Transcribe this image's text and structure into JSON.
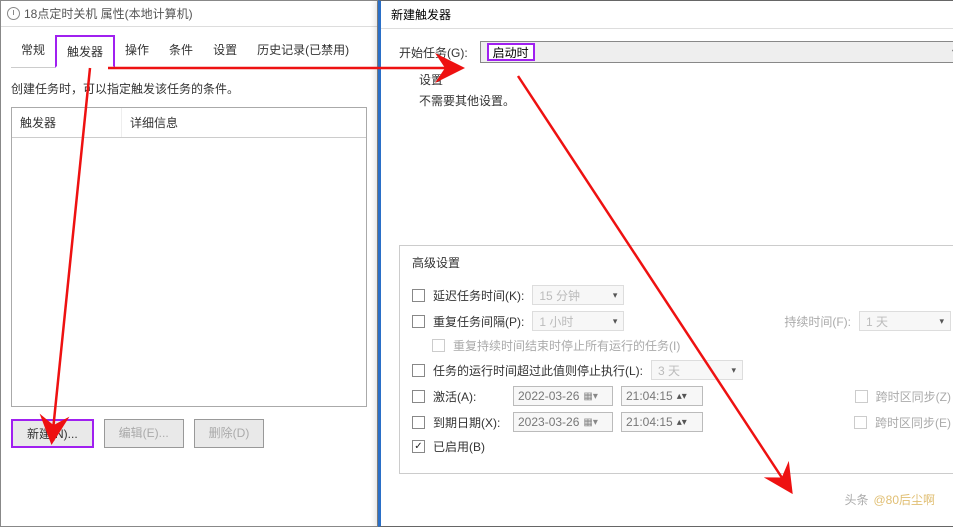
{
  "parent_window": {
    "title": "18点定时关机 属性(本地计算机)",
    "tabs": {
      "general": "常规",
      "triggers": "触发器",
      "actions": "操作",
      "conditions": "条件",
      "settings": "设置",
      "history": "历史记录(已禁用)"
    },
    "hint": "创建任务时，可以指定触发该任务的条件。",
    "list_headers": {
      "trigger": "触发器",
      "details": "详细信息"
    },
    "buttons": {
      "new": "新建(N)...",
      "edit": "编辑(E)...",
      "delete": "删除(D)"
    }
  },
  "dialog": {
    "title": "新建触发器",
    "begin_label": "开始任务(G):",
    "begin_value": "启动时",
    "settings_label": "设置",
    "no_settings_text": "不需要其他设置。",
    "advanced": {
      "group_title": "高级设置",
      "delay_label": "延迟任务时间(K):",
      "delay_value": "15 分钟",
      "repeat_label": "重复任务间隔(P):",
      "repeat_value": "1 小时",
      "duration_label": "持续时间(F):",
      "duration_value": "1 天",
      "repeat_stop_label": "重复持续时间结束时停止所有运行的任务(I)",
      "stop_if_label": "任务的运行时间超过此值则停止执行(L):",
      "stop_if_value": "3 天",
      "activate_label": "激活(A):",
      "activate_date": "2022-03-26",
      "activate_time": "21:04:15",
      "expire_label": "到期日期(X):",
      "expire_date": "2023-03-26",
      "expire_time": "21:04:15",
      "tz_sync_z": "跨时区同步(Z)",
      "tz_sync_e": "跨时区同步(E)",
      "enabled_label": "已启用(B)"
    }
  },
  "watermark": {
    "a": "头条",
    "b": "@80后尘啊"
  }
}
